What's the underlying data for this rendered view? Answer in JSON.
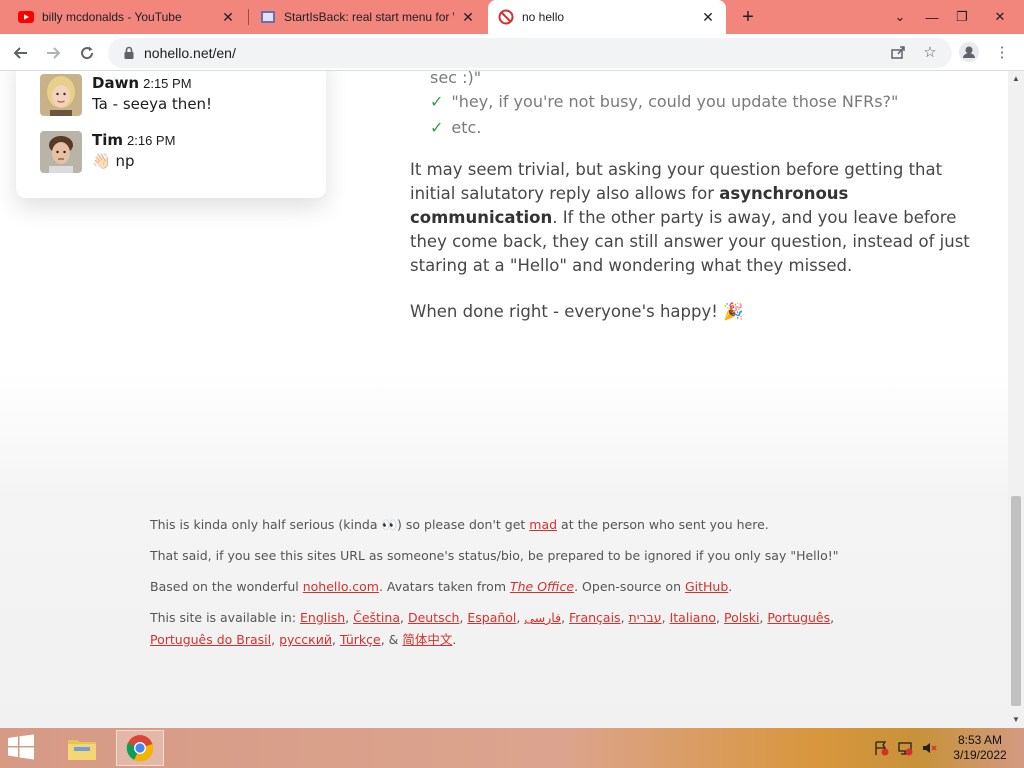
{
  "browser": {
    "tabs": [
      {
        "title": "billy mcdonalds - YouTube",
        "icon": "youtube-icon"
      },
      {
        "title": "StartIsBack: real start menu for W",
        "icon": "startisback-icon"
      },
      {
        "title": "no hello",
        "icon": "no-sign-icon",
        "active": true
      }
    ],
    "url": "nohello.net/en/"
  },
  "chat": [
    {
      "name": "Dawn",
      "time": "2:15 PM",
      "text": "Ta - seeya then!"
    },
    {
      "name": "Tim",
      "time": "2:16 PM",
      "text": "👋🏻 np"
    }
  ],
  "article": {
    "checklist": [
      "sec :)\"",
      "\"hey, if you're not busy, could you update those NFRs?\"",
      "etc."
    ],
    "check_mark": "✓",
    "para1_before": "It may seem trivial, but asking your question before getting that initial salutatory reply also allows for ",
    "para1_bold": "asynchronous communication",
    "para1_after": ". If the other party is away, and you leave before they come back, they can still answer your question, instead of just staring at a \"Hello\" and wondering what they missed.",
    "para2": "When done right - everyone's happy! 🎉"
  },
  "footer": {
    "line1_before": "This is kinda only half serious (kinda 👀) so please don't get ",
    "line1_link": "mad",
    "line1_after": " at the person who sent you here.",
    "line2": "That said, if you see this sites URL as someone's status/bio, be prepared to be ignored if you only say \"Hello!\"",
    "line3_a": "Based on the wonderful ",
    "line3_link1": "nohello.com",
    "line3_b": ". Avatars taken from ",
    "line3_link2": "The Office",
    "line3_c": ". Open-source on ",
    "line3_link3": "GitHub",
    "line3_d": ".",
    "line4_prefix": "This site is available in: ",
    "languages": [
      "English",
      "Čeština",
      "Deutsch",
      "Español",
      "فارسی",
      "Français",
      "עברית",
      "Italiano",
      "Polski",
      "Português",
      "Português do Brasil",
      "русский",
      "Türkçe"
    ],
    "last_language": "简体中文",
    "amp": "&"
  },
  "taskbar": {
    "time": "8:53 AM",
    "date": "3/19/2022"
  },
  "colors": {
    "tabbar": "#f2857c",
    "link": "#d9302b",
    "check": "#3a9a4a"
  }
}
